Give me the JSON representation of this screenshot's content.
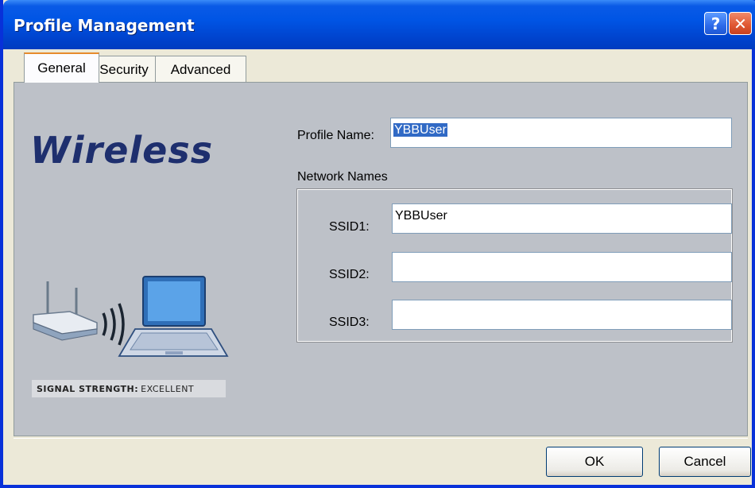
{
  "window": {
    "title": "Profile Management",
    "help_glyph": "?",
    "close_glyph": "✕"
  },
  "tabs": [
    {
      "label": "General",
      "active": true
    },
    {
      "label": "Security",
      "active": false
    },
    {
      "label": "Advanced",
      "active": false
    }
  ],
  "left_panel": {
    "logo_text": "Wireless",
    "signal_strength_label": "SIGNAL STRENGTH:",
    "signal_strength_value": "EXCELLENT"
  },
  "form": {
    "profile_name_label": "Profile Name:",
    "profile_name_value": "YBBUser",
    "network_names_label": "Network Names",
    "ssids": [
      {
        "label": "SSID1:",
        "value": "YBBUser"
      },
      {
        "label": "SSID2:",
        "value": ""
      },
      {
        "label": "SSID3:",
        "value": ""
      }
    ]
  },
  "buttons": {
    "ok_label": "OK",
    "cancel_label": "Cancel"
  },
  "colors": {
    "titlebar": "#0055E5",
    "panel": "#BDC1C8",
    "logo": "#1E2F6E",
    "selection": "#316AC5"
  }
}
